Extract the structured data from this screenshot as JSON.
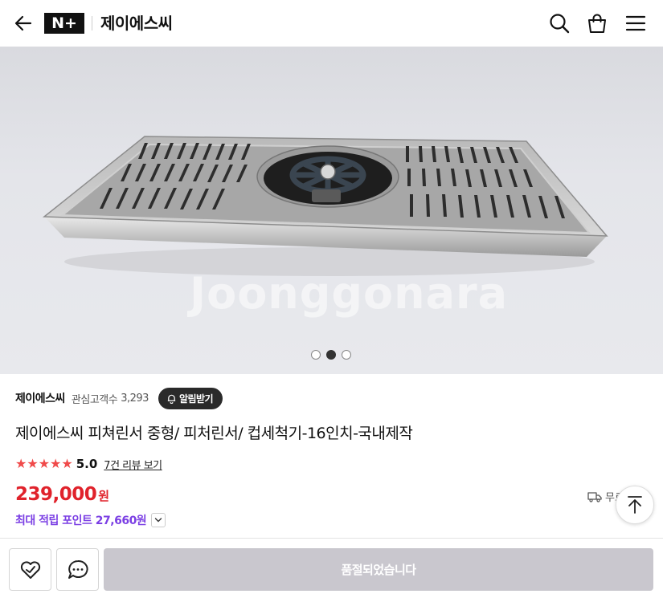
{
  "header": {
    "logo_text": "N+",
    "store_title": "제이에스씨",
    "icons": [
      "back-arrow-icon",
      "search-icon",
      "shopping-bag-icon",
      "menu-icon"
    ]
  },
  "hero": {
    "watermark": "Joonggonara",
    "slides_total": 3,
    "active_slide": 2
  },
  "store": {
    "name": "제이에스씨",
    "followers_label": "관심고객수",
    "followers_count": "3,293",
    "alarm_label": "알림받기"
  },
  "product": {
    "title": "제이에스씨 피쳐린서 중형/ 피처린서/ 컵세척기-16인치-국내제작",
    "rating": "5.0",
    "stars": 5,
    "review_link": "7건 리뷰 보기",
    "price": "239,000",
    "price_unit": "원",
    "delivery_label": "무료",
    "points_text": "최대 적립 포인트 27,660원"
  },
  "bottom_bar": {
    "soldout_label": "품절되었습니다"
  },
  "colors": {
    "price": "#e0222b",
    "points": "#7b3fe4",
    "stars": "#f04a4a",
    "soldout_button": "#c9c7ce"
  }
}
